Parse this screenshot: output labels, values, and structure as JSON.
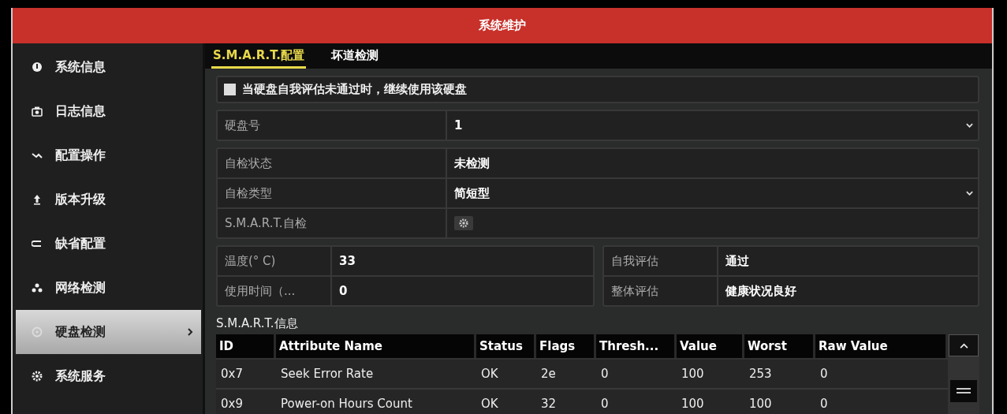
{
  "window": {
    "title": "系统维护"
  },
  "sidebar": {
    "items": [
      {
        "label": "系统信息",
        "selected": false
      },
      {
        "label": "日志信息",
        "selected": false
      },
      {
        "label": "配置操作",
        "selected": false
      },
      {
        "label": "版本升级",
        "selected": false
      },
      {
        "label": "缺省配置",
        "selected": false
      },
      {
        "label": "网络检测",
        "selected": false
      },
      {
        "label": "硬盘检测",
        "selected": true
      },
      {
        "label": "系统服务",
        "selected": false
      }
    ]
  },
  "tabs": [
    {
      "label": "S.M.A.R.T.配置",
      "selected": true
    },
    {
      "label": "坏道检测",
      "selected": false
    }
  ],
  "option": {
    "label": "当硬盘自我评估未通过时，继续使用该硬盘",
    "checked": false
  },
  "panels": [
    [
      {
        "kind": "select",
        "label": "硬盘号",
        "value": "1"
      }
    ],
    [
      {
        "kind": "text",
        "label": "自检状态",
        "value": "未检测"
      },
      {
        "kind": "select",
        "label": "自检类型",
        "value": "简短型"
      },
      {
        "kind": "button",
        "label": "S.M.A.R.T.自检"
      }
    ]
  ],
  "stats": [
    [
      {
        "label": "温度(° C)",
        "value": "33"
      },
      {
        "label": "使用时间（...",
        "value": "0"
      }
    ],
    [
      {
        "label": "自我评估",
        "value": "通过"
      },
      {
        "label": "整体评估",
        "value": "健康状况良好"
      }
    ]
  ],
  "smart_info": {
    "title": "S.M.A.R.T.信息",
    "columns": [
      "ID",
      "Attribute Name",
      "Status",
      "Flags",
      "Thresh...",
      "Value",
      "Worst",
      "Raw Value"
    ],
    "rows": [
      [
        "0x7",
        "Seek Error Rate",
        "OK",
        "2e",
        "0",
        "100",
        "253",
        "0"
      ],
      [
        "0x9",
        "Power-on Hours Count",
        "OK",
        "32",
        "0",
        "100",
        "100",
        "0"
      ]
    ]
  }
}
